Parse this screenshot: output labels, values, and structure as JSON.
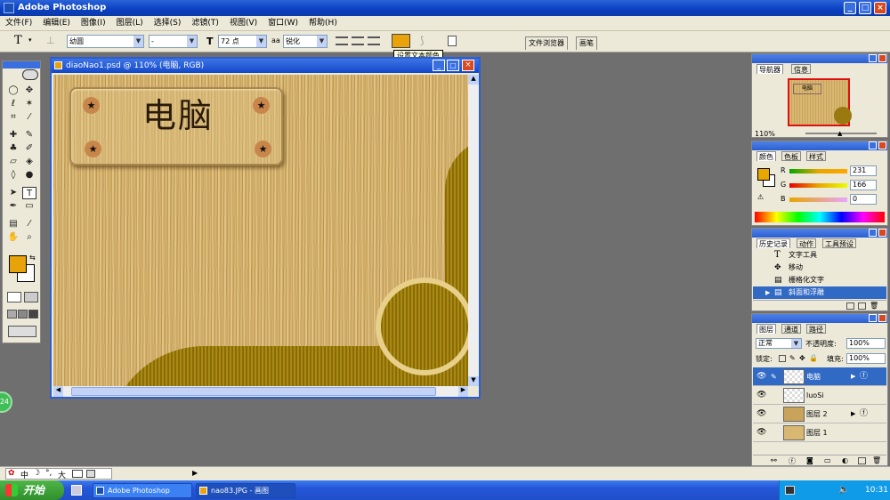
{
  "app": {
    "title": "Adobe Photoshop",
    "colors": {
      "title": "#0a3fc2",
      "accent": "#e8a20a"
    }
  },
  "menu": [
    "文件(F)",
    "编辑(E)",
    "图像(I)",
    "图层(L)",
    "选择(S)",
    "滤镜(T)",
    "视图(V)",
    "窗口(W)",
    "帮助(H)"
  ],
  "options": {
    "font_family": "幼圆",
    "font_style": "-",
    "font_size": "72 点",
    "antialias": "锐化",
    "color_tooltip": "设置文本颜色",
    "file_browser": "文件浏览器",
    "brushes": "画笔",
    "text_color": "#e8a20a"
  },
  "document": {
    "title": "diaoNao1.psd @ 110% (电脑, RGB)",
    "sign_text": "电脑"
  },
  "navigator": {
    "tabs": [
      "导航器",
      "信息"
    ],
    "zoom": "110%",
    "mini_sign": "电脑"
  },
  "color_panel": {
    "tabs": [
      "颜色",
      "色板",
      "样式"
    ],
    "r_label": "R",
    "g_label": "G",
    "b_label": "B",
    "r": "231",
    "g": "166",
    "b": "0",
    "fg": "#e8a600"
  },
  "history": {
    "tabs": [
      "历史记录",
      "动作",
      "工具预设"
    ],
    "items": [
      "文字工具",
      "移动",
      "栅格化文字",
      "斜面和浮雕"
    ]
  },
  "layers": {
    "tabs": [
      "图层",
      "通道",
      "路径"
    ],
    "blend": "正常",
    "opacity_label": "不透明度:",
    "opacity": "100%",
    "lock_label": "锁定:",
    "fill_label": "填充:",
    "fill": "100%",
    "items": [
      "电脑",
      "luoSi",
      "图层 2",
      "图层 1"
    ]
  },
  "status": {
    "ime": "中",
    "badge": "24"
  },
  "taskbar": {
    "start": "开始",
    "tasks": [
      "Adobe Photoshop",
      "nao83.JPG - 画图"
    ],
    "clock": "10:31"
  }
}
